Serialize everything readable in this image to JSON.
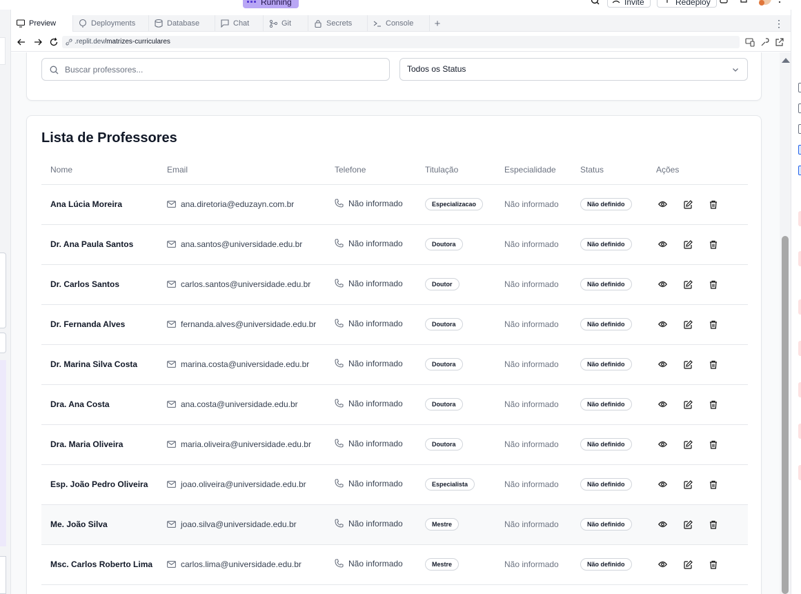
{
  "topbar": {
    "running_label": "Running",
    "invite_label": "Invite",
    "redeploy_label": "Redeploy"
  },
  "tabs": [
    {
      "label": "Preview",
      "icon": "monitor-icon",
      "active": true
    },
    {
      "label": "Deployments",
      "icon": "deploy-icon",
      "active": false
    },
    {
      "label": "Database",
      "icon": "database-icon",
      "active": false
    },
    {
      "label": "Chat",
      "icon": "chat-icon",
      "active": false
    },
    {
      "label": "Git",
      "icon": "git-icon",
      "active": false
    },
    {
      "label": "Secrets",
      "icon": "lock-icon",
      "active": false
    },
    {
      "label": "Console",
      "icon": "terminal-icon",
      "active": false
    }
  ],
  "address": {
    "domain": ".replit.dev",
    "path": "/matrizes-curriculares"
  },
  "filters": {
    "search_placeholder": "Buscar professores...",
    "status_selected": "Todos os Status"
  },
  "list": {
    "title": "Lista de Professores",
    "columns": [
      "Nome",
      "Email",
      "Telefone",
      "Titulação",
      "Especialidade",
      "Status",
      "Ações"
    ],
    "rows": [
      {
        "name": "Ana Lúcia Moreira",
        "email": "ana.diretoria@eduzayn.com.br",
        "phone": "Não informado",
        "title": "Especializacao",
        "specialty": "Não informado",
        "status": "Não definido"
      },
      {
        "name": "Dr. Ana Paula Santos",
        "email": "ana.santos@universidade.edu.br",
        "phone": "Não informado",
        "title": "Doutora",
        "specialty": "Não informado",
        "status": "Não definido"
      },
      {
        "name": "Dr. Carlos Santos",
        "email": "carlos.santos@universidade.edu.br",
        "phone": "Não informado",
        "title": "Doutor",
        "specialty": "Não informado",
        "status": "Não definido"
      },
      {
        "name": "Dr. Fernanda Alves",
        "email": "fernanda.alves@universidade.edu.br",
        "phone": "Não informado",
        "title": "Doutora",
        "specialty": "Não informado",
        "status": "Não definido"
      },
      {
        "name": "Dr. Marina Silva Costa",
        "email": "marina.costa@universidade.edu.br",
        "phone": "Não informado",
        "title": "Doutora",
        "specialty": "Não informado",
        "status": "Não definido"
      },
      {
        "name": "Dra. Ana Costa",
        "email": "ana.costa@universidade.edu.br",
        "phone": "Não informado",
        "title": "Doutora",
        "specialty": "Não informado",
        "status": "Não definido"
      },
      {
        "name": "Dra. Maria Oliveira",
        "email": "maria.oliveira@universidade.edu.br",
        "phone": "Não informado",
        "title": "Doutora",
        "specialty": "Não informado",
        "status": "Não definido"
      },
      {
        "name": "Esp. João Pedro Oliveira",
        "email": "joao.oliveira@universidade.edu.br",
        "phone": "Não informado",
        "title": "Especialista",
        "specialty": "Não informado",
        "status": "Não definido"
      },
      {
        "name": "Me. João Silva",
        "email": "joao.silva@universidade.edu.br",
        "phone": "Não informado",
        "title": "Mestre",
        "specialty": "Não informado",
        "status": "Não definido"
      },
      {
        "name": "Msc. Carlos Roberto Lima",
        "email": "carlos.lima@universidade.edu.br",
        "phone": "Não informado",
        "title": "Mestre",
        "specialty": "Não informado",
        "status": "Não definido"
      }
    ],
    "highlighted_row": 8
  }
}
